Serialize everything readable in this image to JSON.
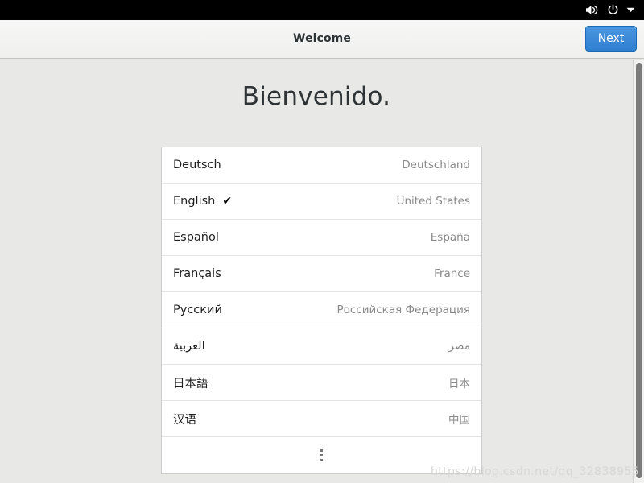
{
  "topbar": {
    "icons": [
      {
        "name": "volume-icon",
        "label": "volume"
      },
      {
        "name": "power-icon",
        "label": "power"
      },
      {
        "name": "chevron-down-icon",
        "label": "▾"
      }
    ]
  },
  "header": {
    "title": "Welcome",
    "next_label": "Next"
  },
  "main": {
    "welcome_title": "Bienvenido.",
    "more_label": "more-languages"
  },
  "languages": [
    {
      "language": "Deutsch",
      "region": "Deutschland",
      "selected": false,
      "check": ""
    },
    {
      "language": "English",
      "region": "United States",
      "selected": true,
      "check": "✔"
    },
    {
      "language": "Español",
      "region": "España",
      "selected": false,
      "check": ""
    },
    {
      "language": "Français",
      "region": "France",
      "selected": false,
      "check": ""
    },
    {
      "language": "Русский",
      "region": "Российская Федерация",
      "selected": false,
      "check": ""
    },
    {
      "language": "العربية",
      "region": "مصر",
      "selected": false,
      "check": ""
    },
    {
      "language": "日本語",
      "region": "日本",
      "selected": false,
      "check": ""
    },
    {
      "language": "汉语",
      "region": "中国",
      "selected": false,
      "check": ""
    }
  ],
  "watermark": {
    "text": "https://blog.csdn.net/qq_32838955"
  },
  "colors": {
    "accent": "#2f7fd1",
    "topbar_bg": "#000000",
    "header_bg": "#f2f2f1",
    "content_bg": "#e8e8e7",
    "list_bg": "#ffffff",
    "region_text": "#8a8a8a",
    "title_text": "#2e3436"
  }
}
